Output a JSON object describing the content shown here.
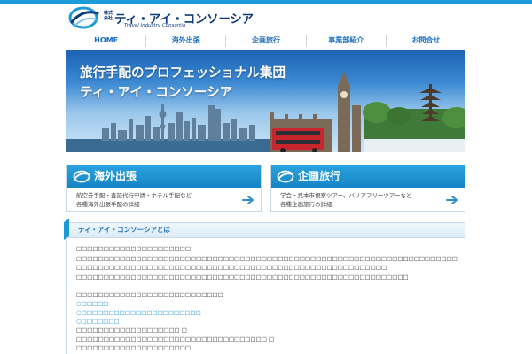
{
  "brand": {
    "kabushiki": "株式会社",
    "name": "ティ・アイ・コンソーシア",
    "sub": "Travel Industry Consortia"
  },
  "nav": [
    "HOME",
    "海外出張",
    "企画旅行",
    "事業部紹介",
    "お問合せ"
  ],
  "hero": {
    "line1": "旅行手配のプロフェッショナル集団",
    "line2": "ティ・アイ・コンソーシア"
  },
  "cards": [
    {
      "title": "海外出張",
      "line1": "航空券手配・査証代行申請・ホテル手配など",
      "line2": "各種海外出張手配の詳細"
    },
    {
      "title": "企画旅行",
      "line1": "学会・見本市視察ツアー、バリアフリーツアーなど",
      "line2": "各種企画旅行の詳細"
    }
  ],
  "about": {
    "title": "ティ・アイ・コンソーシアとは",
    "paras": [
      "□□□□□□□□□□□□□□□□□□□□□",
      "□□□□□□□□□□□□□□□□□□□□□□□□□□□□□□□□□□□□□□□□□□□□□□□□□□□□□□□□□□□□□□□□□□□□□□□",
      "□□□□□□□□□□□□□□□□□□□□□□□□□□□□□□□□□□□□□□□□□□□□□□□□□□□□□□□□□",
      "□□□□□□□□□□□□□□□□□□□□□□□□□□□□□□□□□□□□□□□□□□□□□□□□□□□□□□□□□□□□□"
    ],
    "lines": [
      "□□□□□□□□□□□□□□□□□□□□□□□□□□□",
      "○□□□□□",
      "○□□□□□□□□□□□□□□□□□□□□□□",
      "○□□□□□□□",
      "□□□□□□□□□□□□□□□□□□□ □",
      "□□□□□□□□□□□□□□□□□□□□□□□□□□□□□□□□□□□ □",
      "□□□□□□□□□□□□□□□□□□□□□",
      "□□□□□□□□□□□□"
    ]
  },
  "colors": {
    "accent": "#1d9ad8",
    "nav_text": "#1b6fc2",
    "card_head": "#1684c5",
    "brand_navy": "#0f3b7a"
  }
}
